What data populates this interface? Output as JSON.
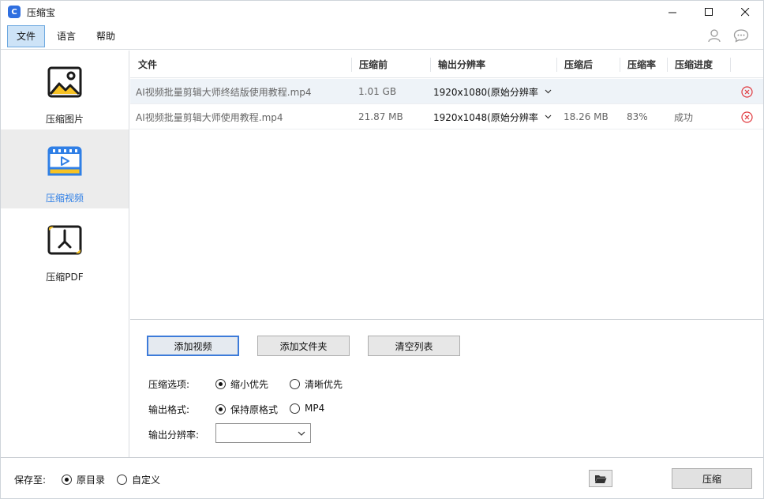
{
  "app": {
    "title": "压缩宝",
    "icon_letter": "C"
  },
  "window_controls": {
    "minimize": "–",
    "maximize": "☐",
    "close": "✕"
  },
  "menu": {
    "items": [
      "文件",
      "语言",
      "帮助"
    ],
    "active_index": 0
  },
  "sidebar": {
    "items": [
      {
        "label": "压缩图片",
        "icon": "image-icon"
      },
      {
        "label": "压缩视频",
        "icon": "video-icon"
      },
      {
        "label": "压缩PDF",
        "icon": "pdf-icon"
      }
    ],
    "active_index": 1
  },
  "table": {
    "headers": [
      "文件",
      "压缩前",
      "输出分辨率",
      "压缩后",
      "压缩率",
      "压缩进度"
    ],
    "rows": [
      {
        "file": "AI视频批量剪辑大师终结版使用教程.mp4",
        "before": "1.01 GB",
        "resolution": "1920x1080(原始分辨率",
        "after": "",
        "ratio": "",
        "progress": ""
      },
      {
        "file": "AI视频批量剪辑大师使用教程.mp4",
        "before": "21.87 MB",
        "resolution": "1920x1048(原始分辨率",
        "after": "18.26 MB",
        "ratio": "83%",
        "progress": "成功"
      }
    ],
    "selected_row": 0
  },
  "actions": {
    "add_video": "添加视频",
    "add_folder": "添加文件夹",
    "clear_list": "清空列表"
  },
  "options": {
    "compress_label": "压缩选项:",
    "compress_choices": [
      "缩小优先",
      "清晰优先"
    ],
    "compress_selected": 0,
    "format_label": "输出格式:",
    "format_choices": [
      "保持原格式",
      "MP4"
    ],
    "format_selected": 0,
    "resolution_label": "输出分辨率:",
    "resolution_value": ""
  },
  "footer": {
    "save_label": "保存至:",
    "save_choices": [
      "原目录",
      "自定义"
    ],
    "save_selected": 0,
    "compress_button": "压缩"
  },
  "colors": {
    "accent": "#2f7fe6",
    "icon_yellow": "#f7c325",
    "delete_red": "#e0393e"
  }
}
